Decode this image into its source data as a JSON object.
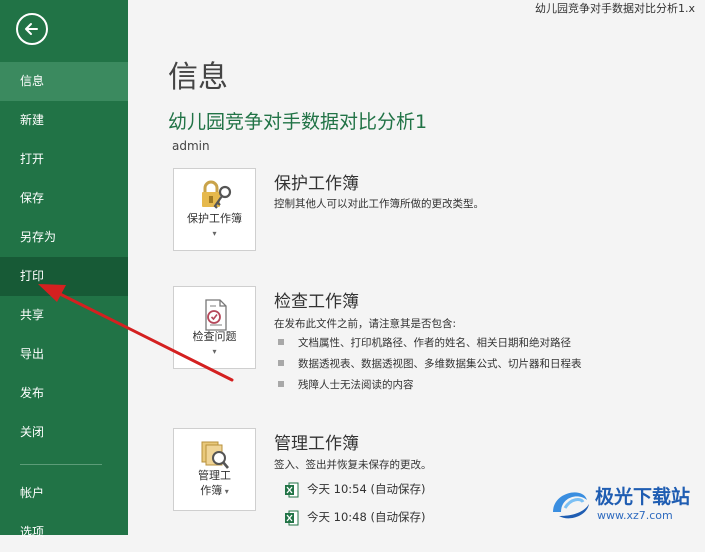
{
  "window": {
    "title": "幼儿园竞争对手数据对比分析1.x"
  },
  "sidebar": {
    "items": [
      {
        "label": "信息"
      },
      {
        "label": "新建"
      },
      {
        "label": "打开"
      },
      {
        "label": "保存"
      },
      {
        "label": "另存为"
      },
      {
        "label": "打印"
      },
      {
        "label": "共享"
      },
      {
        "label": "导出"
      },
      {
        "label": "发布"
      },
      {
        "label": "关闭"
      },
      {
        "label": "帐户"
      },
      {
        "label": "选项"
      }
    ]
  },
  "main": {
    "title": "信息",
    "workbook_name": "幼儿园竞争对手数据对比分析1",
    "author": "admin",
    "protect": {
      "tile_label": "保护工作簿",
      "title": "保护工作簿",
      "description": "控制其他人可以对此工作簿所做的更改类型。"
    },
    "inspect": {
      "tile_label": "检查问题",
      "title": "检查工作簿",
      "description": "在发布此文件之前，请注意其是否包含:",
      "bullets": [
        "文档属性、打印机路径、作者的姓名、相关日期和绝对路径",
        "数据透视表、数据透视图、多维数据集公式、切片器和日程表",
        "残障人士无法阅读的内容"
      ]
    },
    "manage": {
      "tile_label_line1": "管理工",
      "tile_label_line2": "作簿",
      "title": "管理工作簿",
      "description": "签入、签出并恢复未保存的更改。",
      "versions": [
        {
          "label": "今天 10:54 (自动保存)"
        },
        {
          "label": "今天 10:48 (自动保存)"
        }
      ]
    }
  },
  "watermark": {
    "text": "极光下载站",
    "url": "www.xz7.com"
  },
  "colors": {
    "sidebar": "#217346",
    "accent": "#217346",
    "arrow": "#d42020"
  }
}
